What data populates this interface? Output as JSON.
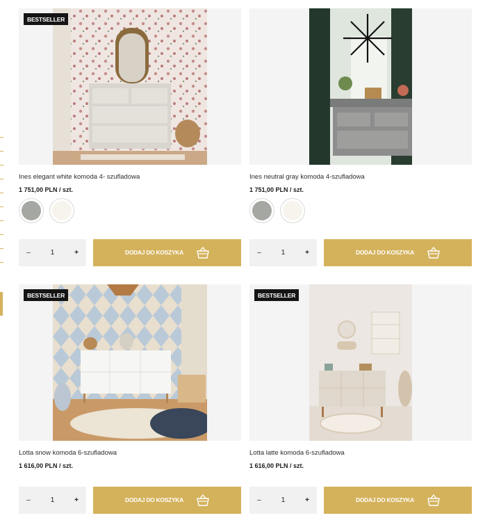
{
  "products": [
    {
      "badge": "BESTSELLER",
      "title": "Ines elegant white komoda 4- szufladowa",
      "price": "1 751,00 PLN / szt.",
      "swatch_colors": [
        "#a5a7a2",
        "#f7f4ee"
      ],
      "quantity": "1",
      "cart_label": "DODAJ DO KOSZYKA"
    },
    {
      "badge": "",
      "title": "Ines neutral gray komoda 4-szufladowa",
      "price": "1 751,00 PLN / szt.",
      "swatch_colors": [
        "#a5a7a2",
        "#f7f4ee"
      ],
      "quantity": "1",
      "cart_label": "DODAJ DO KOSZYKA"
    },
    {
      "badge": "BESTSELLER",
      "title": "Lotta snow komoda 6-szufladowa",
      "price": "1 616,00 PLN / szt.",
      "swatch_colors": [],
      "quantity": "1",
      "cart_label": "DODAJ DO KOSZYKA"
    },
    {
      "badge": "BESTSELLER",
      "title": "Lotta latte komoda 6-szufladowa",
      "price": "1 616,00 PLN / szt.",
      "swatch_colors": [],
      "quantity": "1",
      "cart_label": "DODAJ DO KOSZYKA"
    }
  ],
  "qty_controls": {
    "minus": "–",
    "plus": "+"
  },
  "icons": {
    "cart": "basket-icon"
  },
  "colors": {
    "accent": "#d4b25c",
    "badge_bg": "#151515",
    "qty_bg": "#f1f1f1",
    "image_bg": "#f4f4f5"
  }
}
